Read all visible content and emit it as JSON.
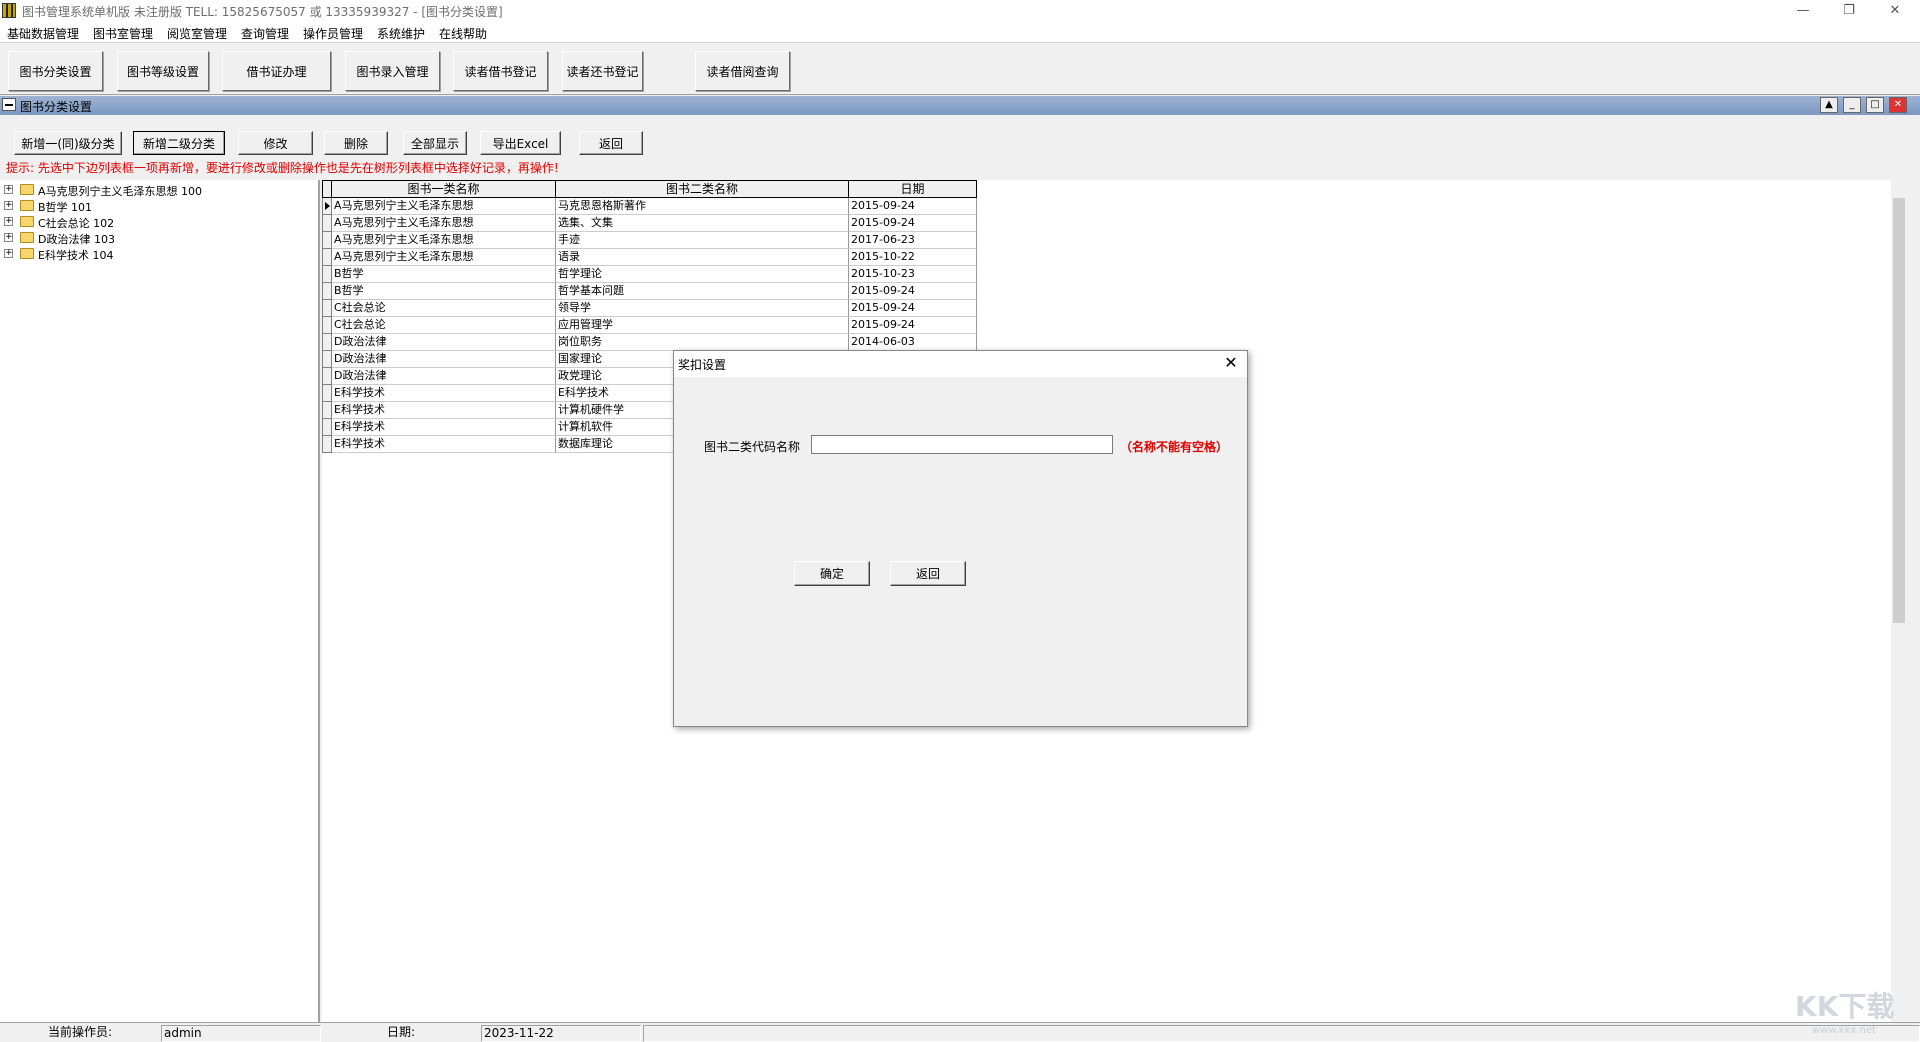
{
  "window": {
    "title": "图书管理系统单机版 未注册版 TELL: 15825675057 或 13335939327 - [图书分类设置]",
    "controls": {
      "minimize": "—",
      "restore": "❐",
      "close": "✕"
    }
  },
  "menu": [
    "基础数据管理",
    "图书室管理",
    "阅览室管理",
    "查询管理",
    "操作员管理",
    "系统维护",
    "在线帮助"
  ],
  "toolbar": [
    "图书分类设置",
    "图书等级设置",
    "借书证办理",
    "图书录入管理",
    "读者借书登记",
    "读者还书登记",
    "读者借阅查询"
  ],
  "child_window": {
    "title": "图书分类设置",
    "controls": {
      "up": "▲",
      "minimize": "_",
      "maximize": "□",
      "close": "✕"
    }
  },
  "actions": [
    "新增一(同)级分类",
    "新增二级分类",
    "修改",
    "删除",
    "全部显示",
    "导出Excel",
    "返回"
  ],
  "hint": "提示: 先选中下边列表框一项再新增，要进行修改或删除操作也是先在树形列表框中选择好记录，再操作!",
  "tree": [
    {
      "label": "A马克思列宁主义毛泽东思想  100"
    },
    {
      "label": "B哲学  101"
    },
    {
      "label": "C社会总论  102"
    },
    {
      "label": "D政治法律  103"
    },
    {
      "label": "E科学技术  104"
    }
  ],
  "grid": {
    "columns": [
      "图书一类名称",
      "图书二类名称",
      "日期"
    ],
    "rows": [
      [
        "A马克思列宁主义毛泽东思想",
        "马克思恩格斯著作",
        "2015-09-24"
      ],
      [
        "A马克思列宁主义毛泽东思想",
        "选集、文集",
        "2015-09-24"
      ],
      [
        "A马克思列宁主义毛泽东思想",
        "手迹",
        "2017-06-23"
      ],
      [
        "A马克思列宁主义毛泽东思想",
        "语录",
        "2015-10-22"
      ],
      [
        "B哲学",
        "哲学理论",
        "2015-10-23"
      ],
      [
        "B哲学",
        "哲学基本问题",
        "2015-09-24"
      ],
      [
        "C社会总论",
        "领导学",
        "2015-09-24"
      ],
      [
        "C社会总论",
        "应用管理学",
        "2015-09-24"
      ],
      [
        "D政治法律",
        "岗位职务",
        "2014-06-03"
      ],
      [
        "D政治法律",
        "国家理论",
        ""
      ],
      [
        "D政治法律",
        "政党理论",
        ""
      ],
      [
        "E科学技术",
        "E科学技术",
        ""
      ],
      [
        "E科学技术",
        "计算机硬件学",
        ""
      ],
      [
        "E科学技术",
        "计算机软件",
        ""
      ],
      [
        "E科学技术",
        "数据库理论",
        ""
      ]
    ]
  },
  "status": {
    "operator_label": "当前操作员:",
    "operator": "admin",
    "date_label": "日期:",
    "date": "2023-11-22"
  },
  "dialog": {
    "title": "奖扣设置",
    "close": "✕",
    "field_label": "图书二类代码名称",
    "field_value": "",
    "note": "（名称不能有空格）",
    "ok": "确定",
    "back": "返回"
  },
  "watermark": {
    "main": "KK下载",
    "sub": "www.kkx.net"
  }
}
